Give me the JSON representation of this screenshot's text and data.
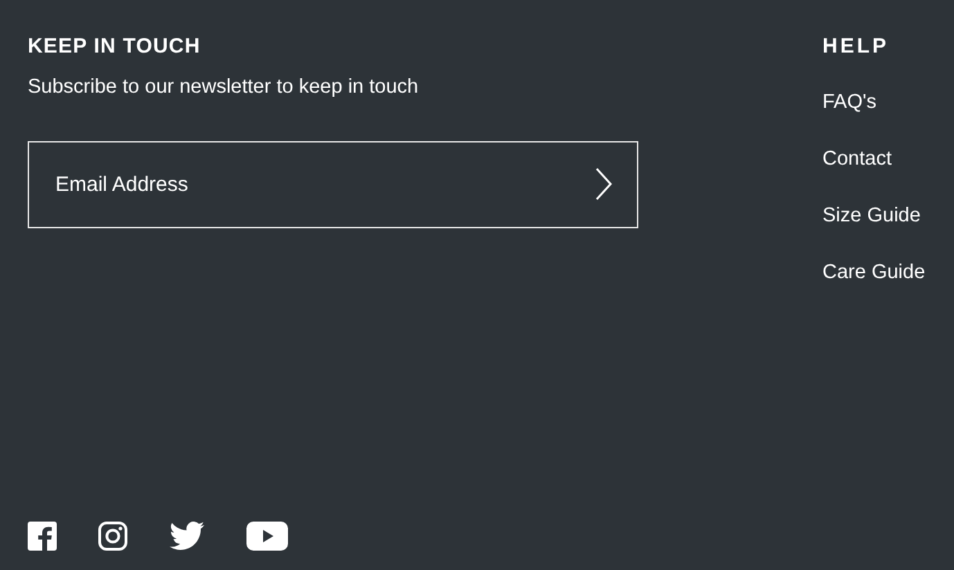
{
  "newsletter": {
    "title": "KEEP IN TOUCH",
    "subtitle": "Subscribe to our newsletter to keep in touch",
    "email_field": {
      "placeholder": "Email Address"
    }
  },
  "help": {
    "title": "HELP",
    "links": [
      "FAQ's",
      "Contact",
      "Size Guide",
      "Care Guide"
    ]
  },
  "social": [
    {
      "kind": "facebook"
    },
    {
      "kind": "instagram"
    },
    {
      "kind": "twitter"
    },
    {
      "kind": "youtube"
    }
  ]
}
